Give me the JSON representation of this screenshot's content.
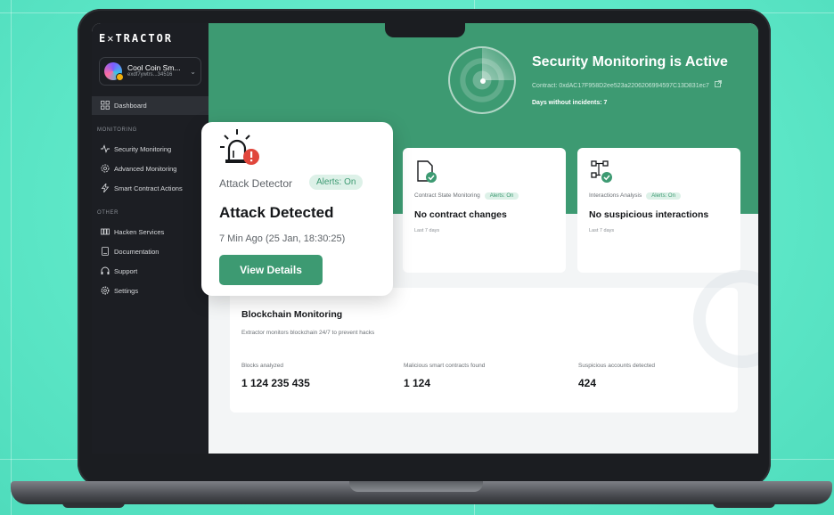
{
  "app": {
    "logo": "E✕TRACTOR"
  },
  "account": {
    "name": "Cool Coin Sm...",
    "address": "exdf7ywtrs...34516"
  },
  "sidebar": {
    "dashboard_label": "Dashboard",
    "monitoring_section": "MONITORING",
    "monitoring_items": [
      {
        "label": "Security Monitoring",
        "icon": "pulse-icon"
      },
      {
        "label": "Advanced Monitoring",
        "icon": "gear-icon"
      },
      {
        "label": "Smart Contract Actions",
        "icon": "bolt-icon"
      }
    ],
    "other_section": "OTHER",
    "other_items": [
      {
        "label": "Hacken Services",
        "icon": "grid-icon"
      },
      {
        "label": "Documentation",
        "icon": "document-icon"
      },
      {
        "label": "Support",
        "icon": "headphones-icon"
      },
      {
        "label": "Settings",
        "icon": "settings-icon"
      }
    ]
  },
  "hero": {
    "title": "Security Monitoring is Active",
    "contract": "Contract: 0xdAC17F958D2ee523a2206206994597C13D831ec7",
    "days": "Days without incidents: 7"
  },
  "cards": [
    {
      "label": "Contract State Monitoring",
      "pill": "Alerts: On",
      "title": "No contract changes",
      "sub": "Last 7 days"
    },
    {
      "label": "Interactions Analysis",
      "pill": "Alerts: On",
      "title": "No suspicious interactions",
      "sub": "Last 7 days"
    }
  ],
  "blockchain": {
    "title": "Blockchain Monitoring",
    "desc": "Extractor monitors blockchain 24/7 to prevent hacks",
    "stats": [
      {
        "label": "Blocks analyzed",
        "value": "1 124 235 435"
      },
      {
        "label": "Malicious smart contracts found",
        "value": "1 124"
      },
      {
        "label": "Suspicious accounts detected",
        "value": "424"
      }
    ]
  },
  "popup": {
    "label": "Attack Detector",
    "pill": "Alerts: On",
    "title": "Attack Detected",
    "time": "7 Min Ago (25 Jan, 18:30:25)",
    "button": "View Details"
  },
  "colors": {
    "accent": "#3d9a72",
    "sidebar": "#1c1e23",
    "background": "#5ee8c8",
    "alert": "#e0463c"
  }
}
